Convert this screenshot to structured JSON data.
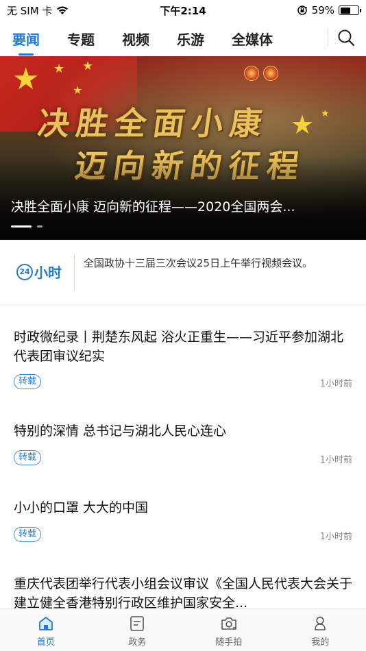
{
  "status_bar": {
    "carrier": "无 SIM 卡",
    "time": "下午2:14",
    "battery": "59%",
    "battery_level": 0.59
  },
  "top_nav": {
    "tabs": [
      {
        "label": "要闻",
        "active": true
      },
      {
        "label": "专题",
        "active": false
      },
      {
        "label": "视频",
        "active": false
      },
      {
        "label": "乐游",
        "active": false
      },
      {
        "label": "全媒体",
        "active": false
      }
    ],
    "search_icon": "search-icon"
  },
  "hero": {
    "calligraphy_line1": "决胜全面小康",
    "calligraphy_line2": "迈向新的征程",
    "title": "决胜全面小康 迈向新的征程——2020全国两会...",
    "slide_count": 2,
    "active_slide": 1
  },
  "hours24": {
    "logo_number": "24",
    "logo_text": "小时",
    "content": "全国政协十三届三次会议25日上午举行视频会议。"
  },
  "news": [
    {
      "title": "时政微纪录丨荆楚东风起 浴火正重生——习近平参加湖北代表团审议纪实",
      "tag": "转载",
      "time": "1小时前"
    },
    {
      "title": "特别的深情 总书记与湖北人民心连心",
      "tag": "转载",
      "time": "1小时前"
    },
    {
      "title": "小小的口罩 大大的中国",
      "tag": "转载",
      "time": "1小时前"
    },
    {
      "title": "重庆代表团举行代表小组会议审议《全国人民代表大会关于建立健全香港特别行政区维护国家安全...",
      "tag": "",
      "time": ""
    }
  ],
  "tab_bar": {
    "items": [
      {
        "label": "首页",
        "icon": "home-icon",
        "active": true
      },
      {
        "label": "政务",
        "icon": "document-icon",
        "active": false
      },
      {
        "label": "随手拍",
        "icon": "camera-icon",
        "active": false
      },
      {
        "label": "我的",
        "icon": "user-icon",
        "active": false
      }
    ]
  },
  "colors": {
    "accent": "#1e7ad9",
    "tag_border": "#3a8be0",
    "muted_text": "#888888"
  }
}
